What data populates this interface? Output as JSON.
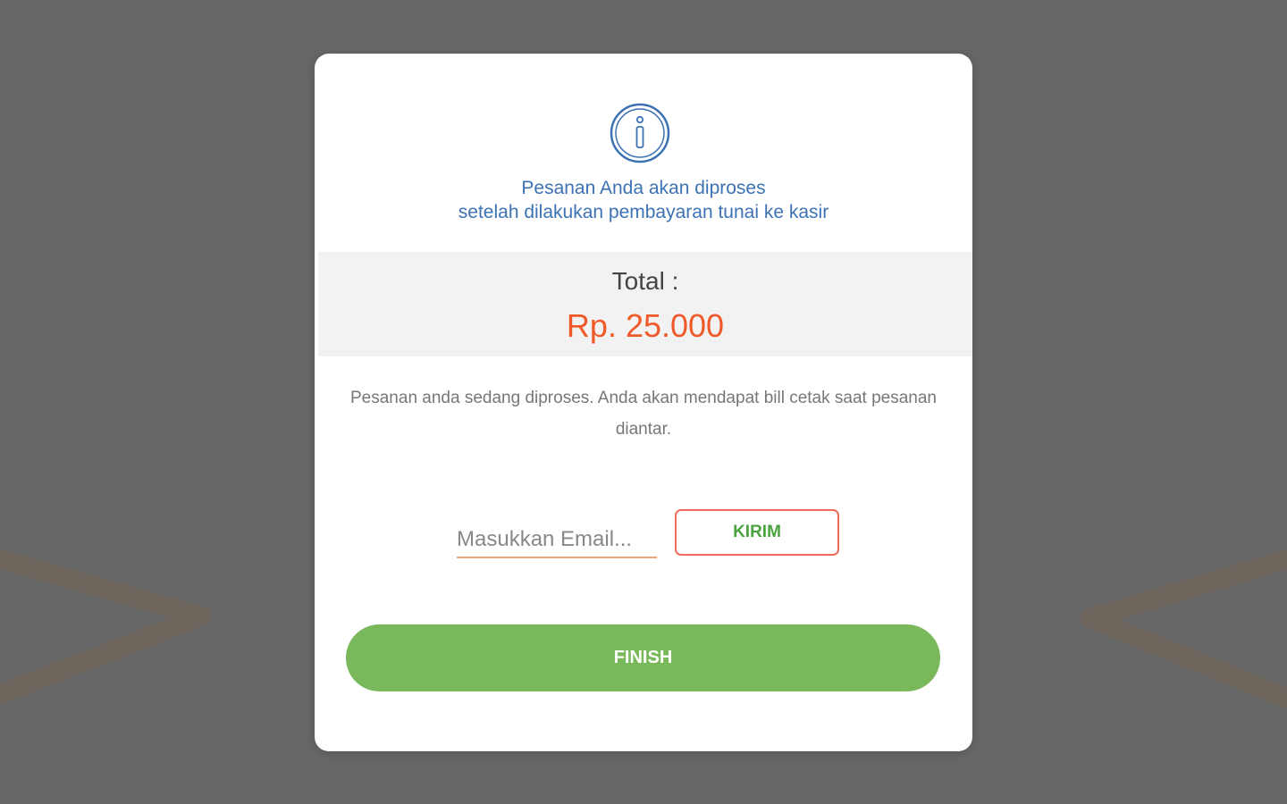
{
  "dialog": {
    "icon": "info-icon",
    "headline_line1": "Pesanan Anda akan diproses",
    "headline_line2": "setelah dilakukan pembayaran tunai ke kasir",
    "total_label": "Total :",
    "total_value": "Rp. 25.000",
    "description": "Pesanan anda sedang diproses. Anda akan mendapat bill cetak saat pesanan diantar.",
    "email_placeholder": "Masukkan Email...",
    "email_value": "",
    "send_label": "KIRIM",
    "finish_label": "FINISH"
  },
  "colors": {
    "overlay": "#666666",
    "headline": "#3d72b4",
    "total_value": "#f05a2a",
    "finish_button": "#79b95b",
    "send_button_border": "#ef6a5a",
    "send_button_text": "#4aa23e"
  }
}
